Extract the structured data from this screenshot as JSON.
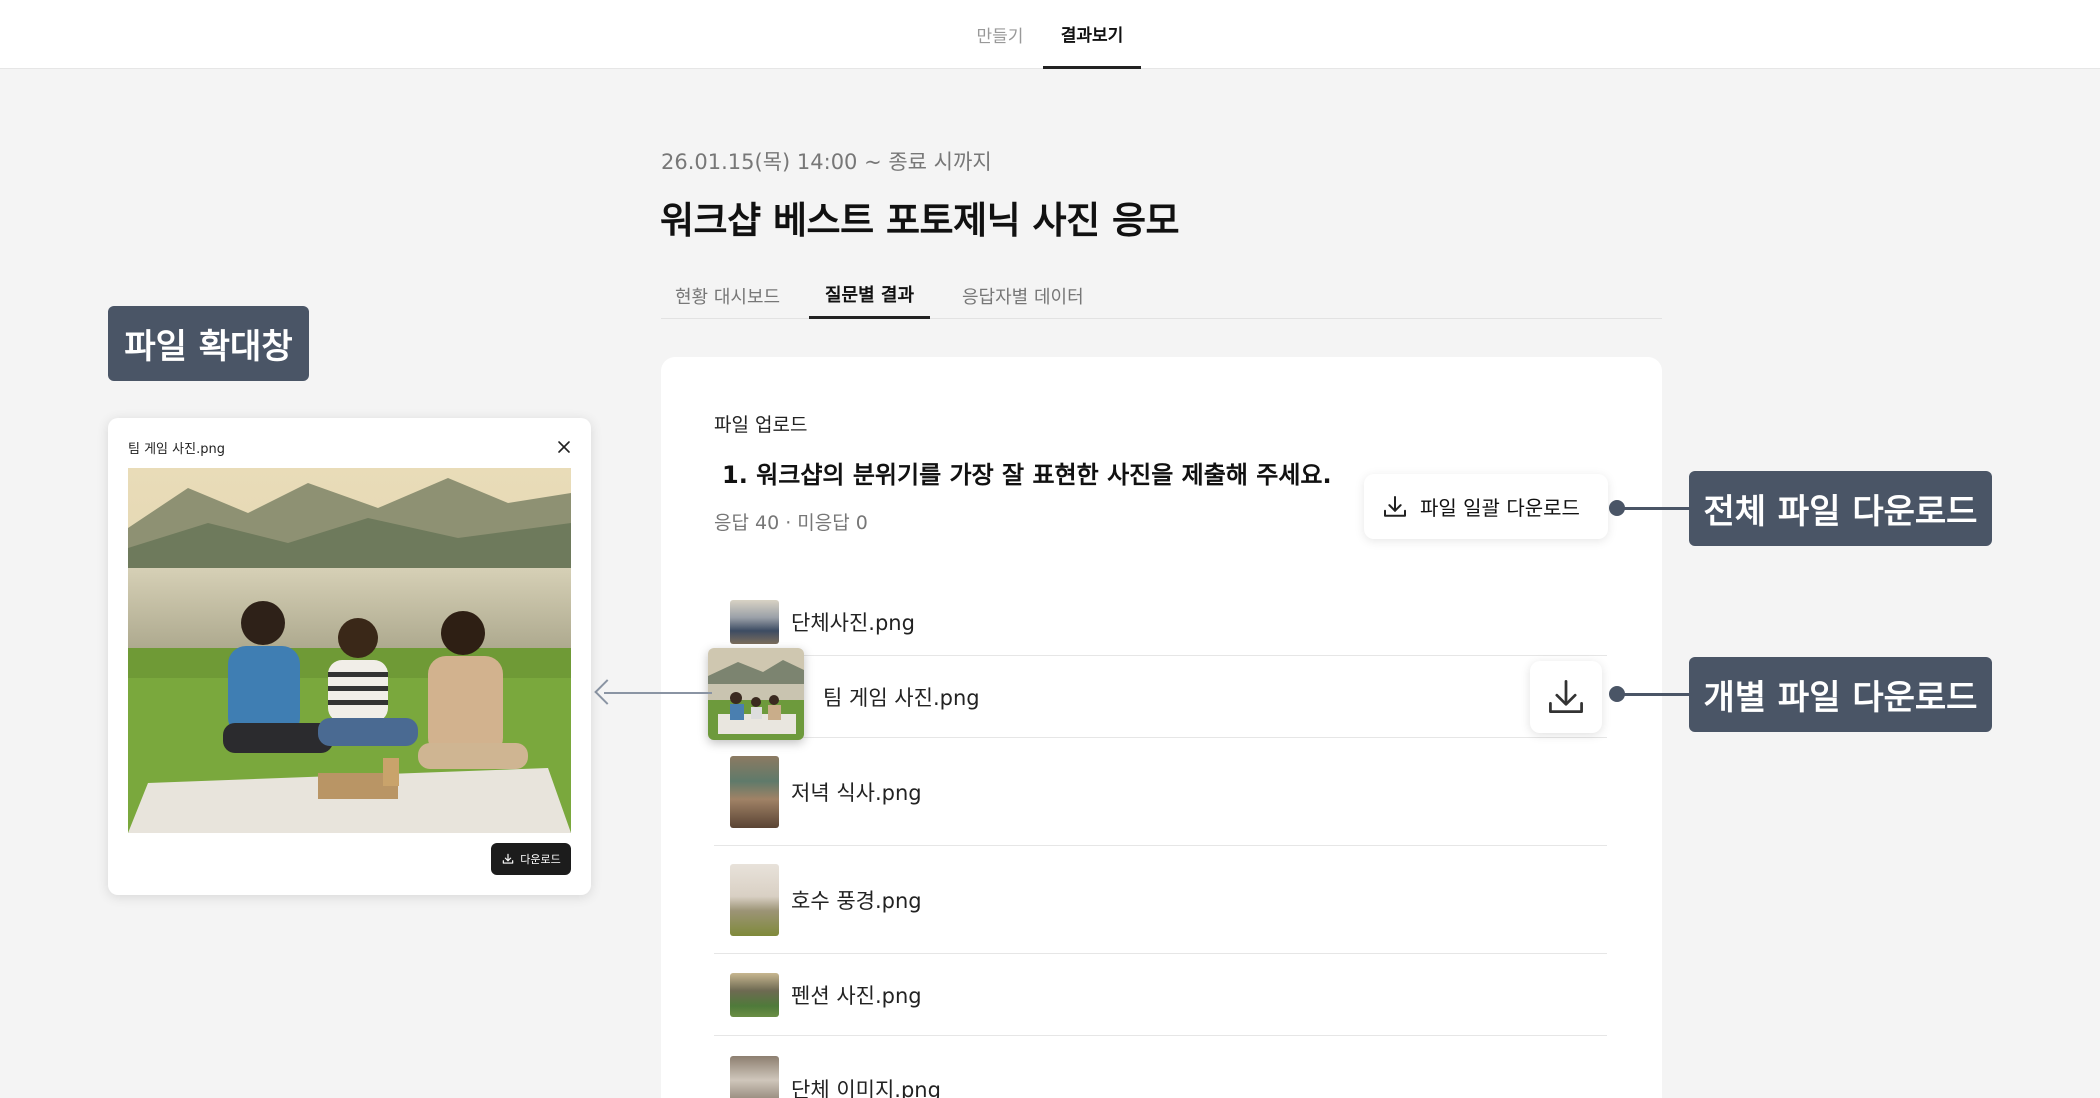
{
  "topnav": {
    "make": "만들기",
    "result": "결과보기"
  },
  "header": {
    "date": "26.01.15(목) 14:00 ~ 종료 시까지",
    "title": "워크샵 베스트 포토제닉 사진 응모"
  },
  "subtabs": [
    "현황 대시보드",
    "질문별 결과",
    "응답자별 데이터"
  ],
  "question": {
    "type": "파일 업로드",
    "text": "1. 워크샵의 분위기를 가장 잘 표현한 사진을 제출해 주세요.",
    "stats": "응답 40 · 미응답 0",
    "bulk_download": "파일 일괄 다운로드"
  },
  "files": [
    "단체사진.png",
    "팀 게임 사진.png",
    "저녁 식사.png",
    "호수 풍경.png",
    "펜션 사진.png",
    "단체 이미지.png"
  ],
  "callouts": {
    "preview": "파일 확대창",
    "bulk": "전체 파일 다운로드",
    "single": "개별 파일 다운로드"
  },
  "modal": {
    "title": "팀 게임 사진.png",
    "download": "다운로드"
  },
  "colors": {
    "callout": "#4a5566",
    "active_tab": "#222222",
    "dark_button": "#1c1c1c"
  },
  "icons": {
    "download": "download-icon",
    "close": "close-icon"
  }
}
